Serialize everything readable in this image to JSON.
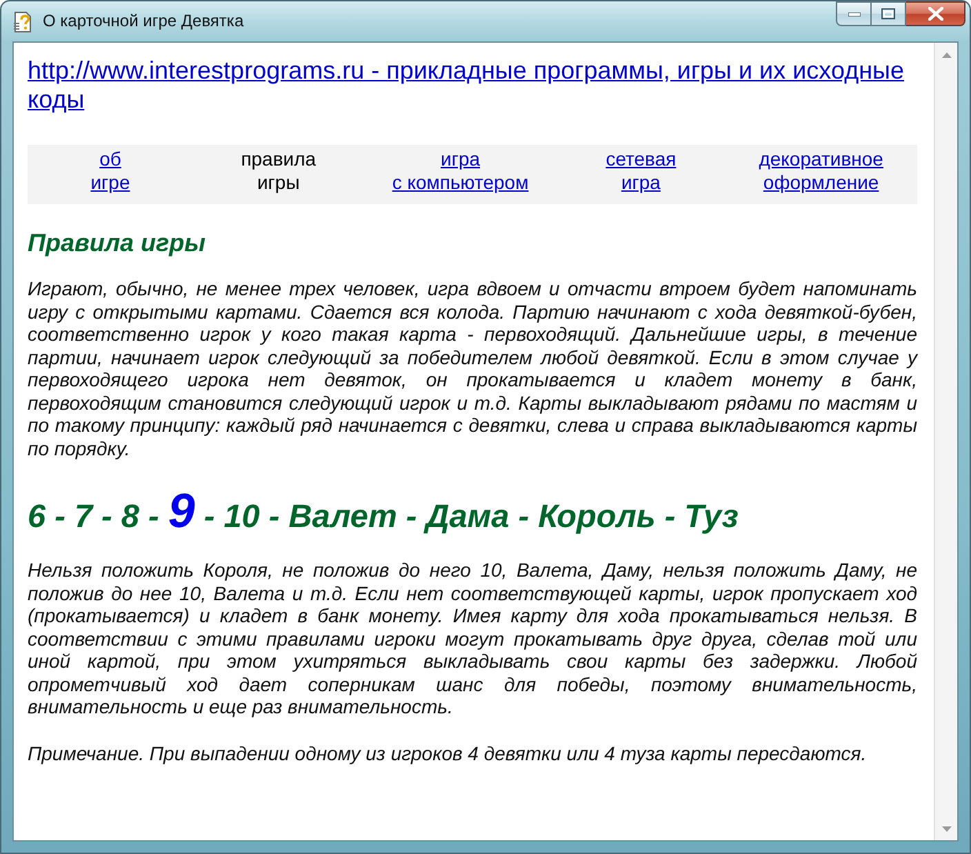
{
  "window": {
    "title": "О карточной игре Девятка"
  },
  "header_link": {
    "text": "http://www.interestprograms.ru - прикладные программы, игры и их исходные коды"
  },
  "nav": [
    {
      "lines": [
        "об",
        "игре"
      ],
      "selected": false
    },
    {
      "lines": [
        "правила",
        "игры"
      ],
      "selected": true
    },
    {
      "lines": [
        "игра",
        "с компьютером"
      ],
      "selected": false
    },
    {
      "lines": [
        "сетевая",
        "игра"
      ],
      "selected": false
    },
    {
      "lines": [
        "декоративное",
        "оформление"
      ],
      "selected": false
    }
  ],
  "section_title": "Правила игры",
  "content": [
    {
      "kind": "paragraph",
      "text": "Играют, обычно, не менее трех человек, игра вдвоем и отчасти втроем будет напоминать игру с открытыми картами. Сдается вся колода. Партию начинают с хода девяткой-бубен, соответственно игрок у кого такая карта - первоходящий. Дальнейшие игры, в течение партии, начинает игрок следующий за победителем любой девяткой. Если в этом случае у первоходящего игрока нет девяток, он прокатывается и кладет монету в банк, первоходящим становится следующий игрок и т.д. Карты выкладывают рядами по мастям и по такому принципу: каждый ряд начинается с девятки, слева и справа выкладываются карты по порядку."
    },
    {
      "kind": "sequence",
      "segments": [
        {
          "text": "6 - 7 - 8 -",
          "highlighted": false
        },
        {
          "text": "9",
          "highlighted": true
        },
        {
          "text": "- 10 - Валет - Дама - Король - Туз",
          "highlighted": false
        }
      ]
    },
    {
      "kind": "paragraph",
      "text": "Нельзя положить Короля, не положив до него 10, Валета, Даму, нельзя положить Даму, не положив до нее 10, Валета и т.д. Если нет соответствующей карты, игрок пропускает ход (прокатывается) и кладет в банк монету. Имея карту для хода прокатываться нельзя. В соответствии с этими правилами игроки могут прокатывать друг друга, сделав той или иной картой, при этом ухитряться выкладывать свои карты без задержки. Любой опрометчивый ход дает соперникам шанс для победы, поэтому внимательность, внимательность и еще раз внимательность."
    },
    {
      "kind": "note",
      "text": "Примечание. При выпадении одному из игроков 4 девятки или 4 туза карты пересдаются."
    }
  ]
}
